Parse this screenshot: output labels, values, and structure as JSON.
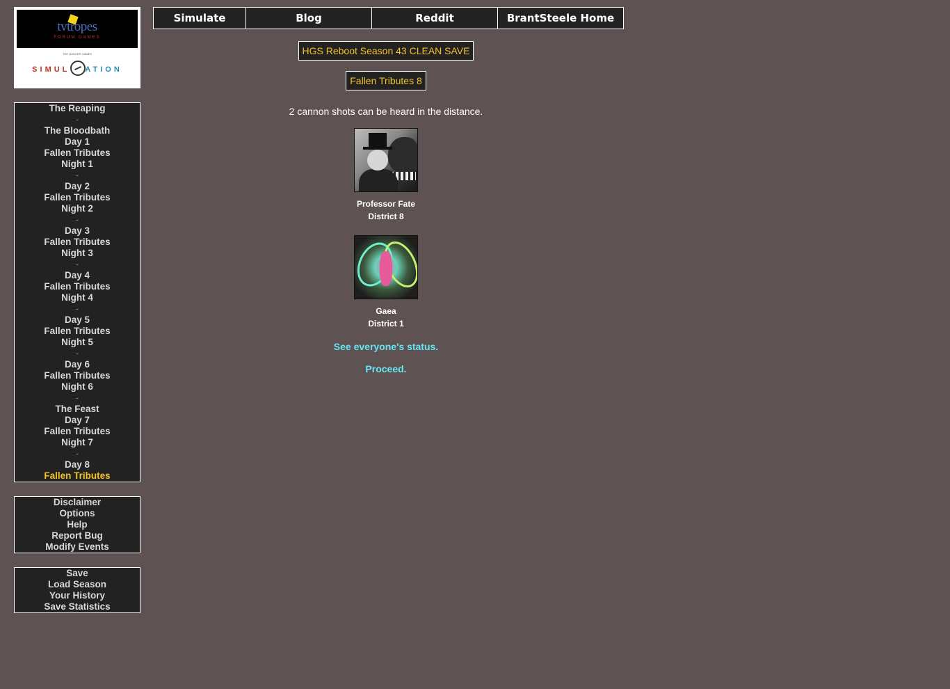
{
  "logo": {
    "top_text": "tvtropes",
    "top_sub": "FORUM GAMES",
    "bottom_small": "THE HUNGER GAMES",
    "bottom_left": "SIMUL",
    "bottom_right": "ATION"
  },
  "topnav": [
    "Simulate",
    "Blog",
    "Reddit",
    "BrantSteele Home"
  ],
  "sidebar": {
    "progress": [
      "The Reaping",
      "-",
      "The Bloodbath",
      "Day 1",
      "Fallen Tributes",
      "Night 1",
      "-",
      "Day 2",
      "Fallen Tributes",
      "Night 2",
      "-",
      "Day 3",
      "Fallen Tributes",
      "Night 3",
      "-",
      "Day 4",
      "Fallen Tributes",
      "Night 4",
      "-",
      "Day 5",
      "Fallen Tributes",
      "Night 5",
      "-",
      "Day 6",
      "Fallen Tributes",
      "Night 6",
      "-",
      "The Feast",
      "Day 7",
      "Fallen Tributes",
      "Night 7",
      "-",
      "Day 8",
      "Fallen Tributes"
    ],
    "info": [
      "Disclaimer",
      "Options",
      "Help",
      "Report Bug",
      "Modify Events"
    ],
    "save": [
      "Save",
      "Load Season",
      "Your History",
      "Save Statistics"
    ]
  },
  "main": {
    "season_title": "HGS Reboot Season 43 CLEAN SAVE",
    "page_title": "Fallen Tributes 8",
    "message": "2 cannon shots can be heard in the distance.",
    "tributes": [
      {
        "name": "Professor Fate",
        "district": "District 8"
      },
      {
        "name": "Gaea",
        "district": "District 1"
      }
    ],
    "status_link": "See everyone's status.",
    "proceed_link": "Proceed."
  }
}
